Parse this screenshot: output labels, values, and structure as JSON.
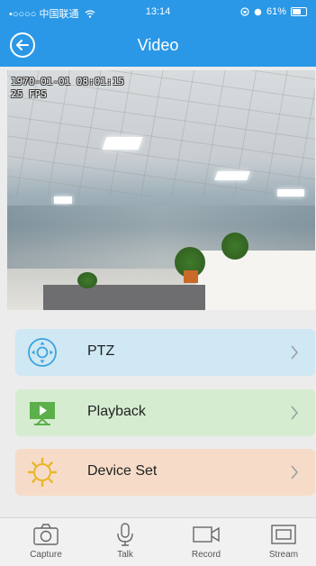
{
  "status_bar": {
    "carrier": "•○○○○ 中国联通",
    "time": "13:14",
    "battery": "61%"
  },
  "nav": {
    "title": "Video"
  },
  "video": {
    "timestamp": "1970-01-01 08:01:15",
    "fps": "25 FPS"
  },
  "menu": [
    {
      "label": "PTZ",
      "icon": "ptz-joystick-icon",
      "bg": "#cfe8f4",
      "icon_color": "#3aa3df"
    },
    {
      "label": "Playback",
      "icon": "monitor-play-icon",
      "bg": "#d5ecd0",
      "icon_color": "#5bb04a"
    },
    {
      "label": "Device Set",
      "icon": "gear-icon",
      "bg": "#f6dcc8",
      "icon_color": "#e9b62b"
    }
  ],
  "toolbar": [
    {
      "label": "Capture",
      "icon": "camera-icon"
    },
    {
      "label": "Talk",
      "icon": "microphone-icon"
    },
    {
      "label": "Record",
      "icon": "video-record-icon"
    },
    {
      "label": "Stream",
      "icon": "stream-icon"
    }
  ],
  "colors": {
    "header": "#2a98e6"
  }
}
